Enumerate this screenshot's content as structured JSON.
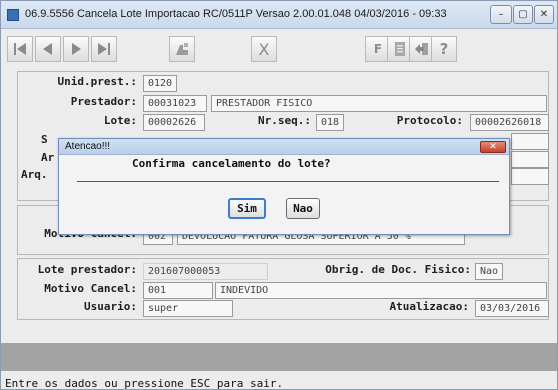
{
  "window": {
    "title": "06.9.5556  Cancela Lote Importacao RC/0511P Versao 2.00.01.048 04/03/2016 - 09:33",
    "minimize": "–",
    "maximize": "▢",
    "close": "✕"
  },
  "toolbar": {
    "first": "first-record-icon",
    "prev": "previous-record-icon",
    "next": "next-record-icon",
    "last": "last-record-icon",
    "go": "go-to-icon",
    "cancel": "X",
    "filter": "F",
    "notes": "notes-icon",
    "exit": "exit-icon",
    "help": "?"
  },
  "form": {
    "unid_prest_label": "Unid.prest.:",
    "unid_prest_value": "0120",
    "prestador_label": "Prestador:",
    "prestador_code": "00031023",
    "prestador_name": "PRESTADOR FISICO",
    "lote_label": "Lote:",
    "lote_value": "00002626",
    "nrseq_label": "Nr.seq.:",
    "nrseq_value": "018",
    "protocolo_label": "Protocolo:",
    "protocolo_value": "00002626018",
    "row4_label_fragment": "S",
    "row5_label_fragment": "Ar",
    "row6_label_fragment": "Arq.",
    "motivo_cancel_label_1": "Motivo Cancel:",
    "motivo_cancel_code_1": "002",
    "motivo_cancel_desc_1": "DEVOLUCAO FATURA GLOSA SUPERIOR A 50 %",
    "lote_prestador_label": "Lote prestador:",
    "lote_prestador_value": "201607000053",
    "obrig_label": "Obrig. de Doc. Fisico:",
    "obrig_value": "Nao",
    "motivo_cancel_label_2": "Motivo Cancel:",
    "motivo_cancel_code_2": "001",
    "motivo_cancel_desc_2": "INDEVIDO",
    "usuario_label": "Usuario:",
    "usuario_value": "super",
    "atualizacao_label": "Atualizacao:",
    "atualizacao_value": "03/03/2016"
  },
  "dialog": {
    "title": "Atencao!!!",
    "close": "✕",
    "message": "Confirma cancelamento do lote?",
    "yes_label": "Sim",
    "no_label": "Nao"
  },
  "status": {
    "text": "Entre os dados ou pressione ESC para sair."
  }
}
